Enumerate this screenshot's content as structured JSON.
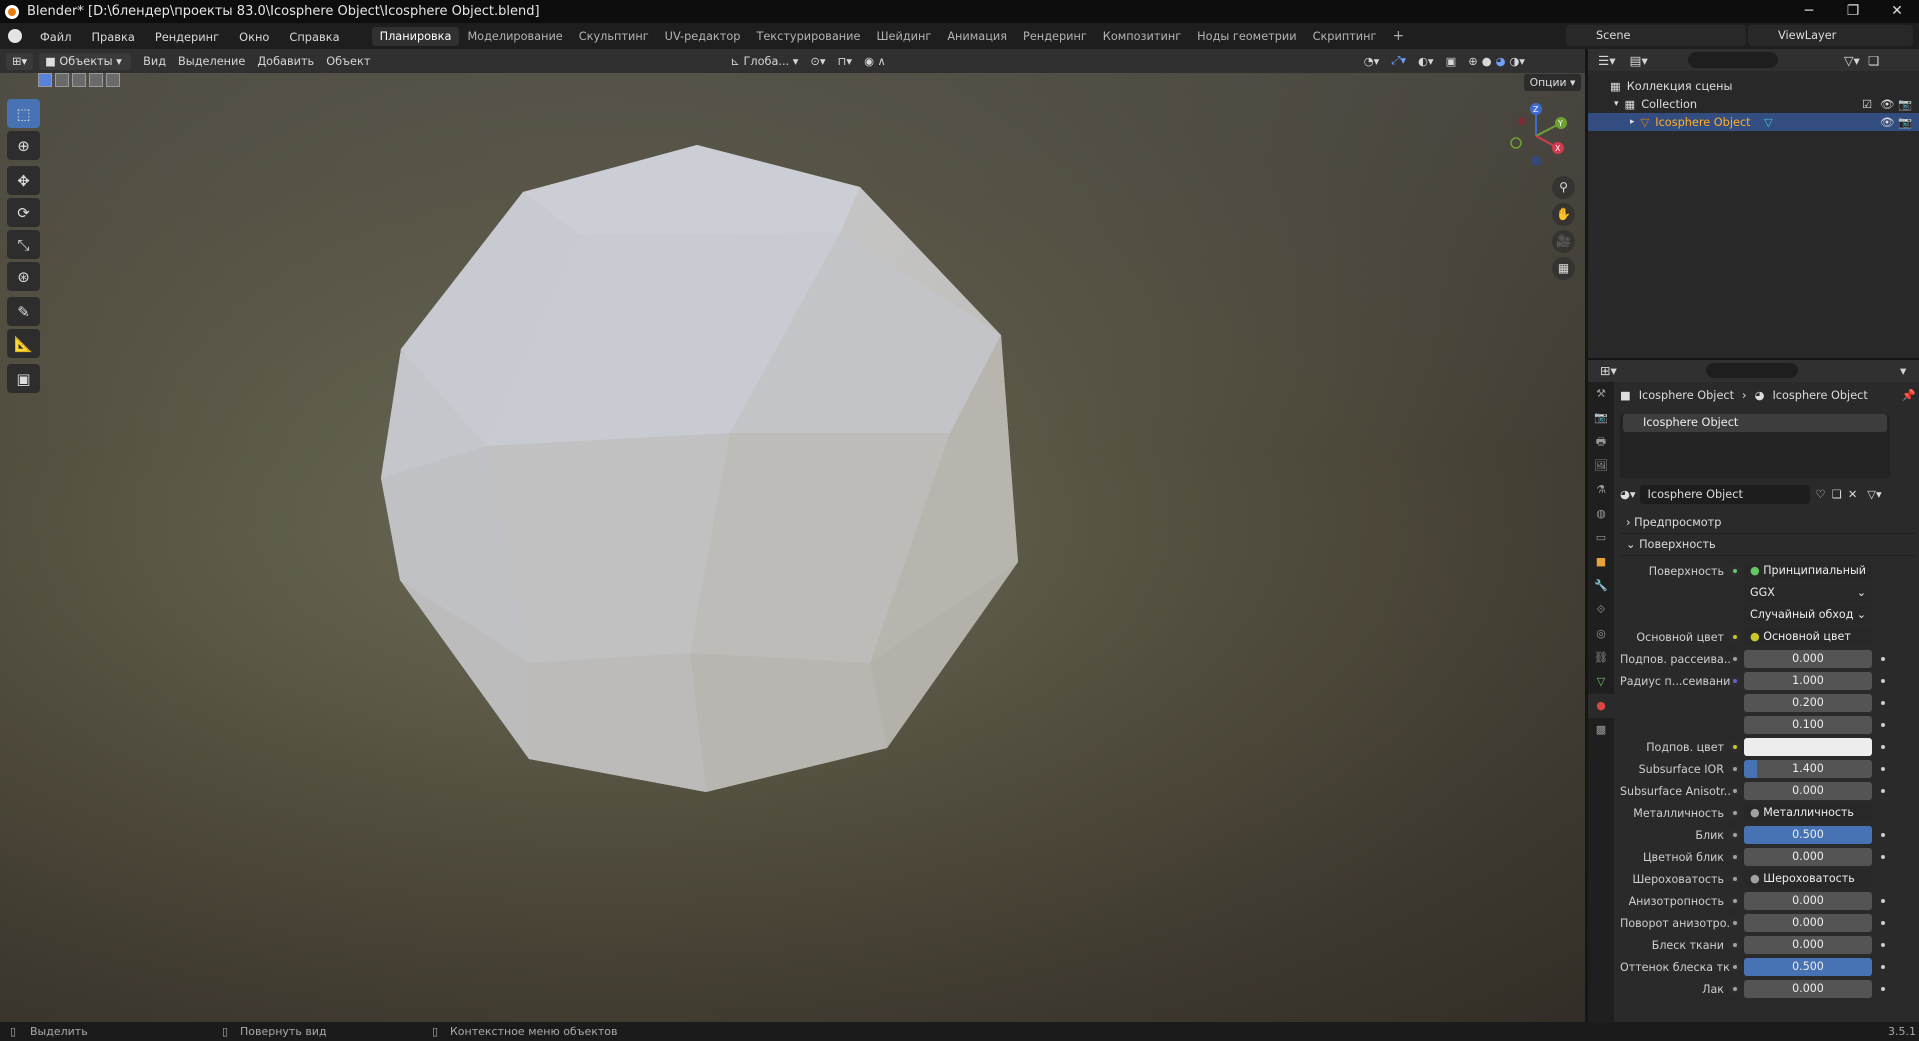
{
  "titlebar": {
    "title": "Blender* [D:\\блендер\\проекты 83.0\\Icosphere Object\\Icosphere Object.blend]",
    "minimize": "─",
    "maximize": "❐",
    "close": "✕"
  },
  "menu": [
    "Файл",
    "Правка",
    "Рендеринг",
    "Окно",
    "Справка"
  ],
  "workspaces": [
    "Планировка",
    "Моделирование",
    "Скульптинг",
    "UV-редактор",
    "Текстурирование",
    "Шейдинг",
    "Анимация",
    "Рендеринг",
    "Композитинг",
    "Ноды геометрии",
    "Скриптинг"
  ],
  "active_workspace": "Планировка",
  "scene": "Scene",
  "viewlayer": "ViewLayer",
  "viewport_header": {
    "mode": "Объекты",
    "menus": [
      "Вид",
      "Выделение",
      "Добавить",
      "Объект"
    ],
    "orientation": "Глоба...",
    "options": "Опции"
  },
  "gizmo": {
    "z": "Z",
    "y": "Y",
    "x": "X"
  },
  "outliner": {
    "root": "Коллекция сцены",
    "collection": "Collection",
    "object": "Icosphere Object"
  },
  "properties": {
    "crumb_obj": "Icosphere Object",
    "crumb_mat": "Icosphere Object",
    "material_slot": "Icosphere Object",
    "material_name": "Icosphere Object",
    "panels": {
      "preview": "Предпросмотр",
      "surface": "Поверхность"
    },
    "rows": [
      {
        "label": "Поверхность",
        "value": "Принципиальный BSDF",
        "kind": "link",
        "socket": "#63c763"
      },
      {
        "label": "",
        "value": "GGX",
        "kind": "dd"
      },
      {
        "label": "",
        "value": "Случайный обход",
        "kind": "dd"
      },
      {
        "label": "Основной цвет",
        "value": "Основной цвет",
        "kind": "link",
        "socket": "#c7c729",
        "expand": true
      },
      {
        "label": "Подпов. рассеива...",
        "value": "0.000",
        "kind": "num",
        "socket": "#a1a1a1"
      },
      {
        "label": "Радиус п...сеивания",
        "value": "1.000",
        "kind": "num",
        "socket": "#6363c7"
      },
      {
        "label": "",
        "value": "0.200",
        "kind": "num"
      },
      {
        "label": "",
        "value": "0.100",
        "kind": "num"
      },
      {
        "label": "Подпов. цвет",
        "value": "",
        "kind": "color",
        "socket": "#c7c729"
      },
      {
        "label": "Subsurface IOR",
        "value": "1.400",
        "kind": "bar",
        "fill": 0.1,
        "socket": "#a1a1a1"
      },
      {
        "label": "Subsurface Anisotr...",
        "value": "0.000",
        "kind": "num",
        "socket": "#a1a1a1"
      },
      {
        "label": "Металличность",
        "value": "Металличность",
        "kind": "link",
        "socket": "#a1a1a1",
        "expand": true
      },
      {
        "label": "Блик",
        "value": "0.500",
        "kind": "bar",
        "fill": 1.0,
        "socket": "#a1a1a1"
      },
      {
        "label": "Цветной блик",
        "value": "0.000",
        "kind": "num",
        "socket": "#a1a1a1"
      },
      {
        "label": "Шероховатость",
        "value": "Шероховатость",
        "kind": "link",
        "socket": "#a1a1a1",
        "expand": true
      },
      {
        "label": "Анизотропность",
        "value": "0.000",
        "kind": "num",
        "socket": "#a1a1a1"
      },
      {
        "label": "Поворот анизотро...",
        "value": "0.000",
        "kind": "num",
        "socket": "#a1a1a1"
      },
      {
        "label": "Блеск ткани",
        "value": "0.000",
        "kind": "num",
        "socket": "#a1a1a1"
      },
      {
        "label": "Оттенок блеска тк...",
        "value": "0.500",
        "kind": "bar",
        "fill": 1.0,
        "socket": "#a1a1a1"
      },
      {
        "label": "Лак",
        "value": "0.000",
        "kind": "num",
        "socket": "#a1a1a1"
      }
    ]
  },
  "statusbar": {
    "select": "Выделить",
    "rotate": "Повернуть вид",
    "context": "Контекстное меню объектов",
    "version": "3.5.1"
  },
  "colors": {
    "accent": "#4772b3",
    "selection": "#334d80",
    "object_orange": "#e87d0d"
  }
}
